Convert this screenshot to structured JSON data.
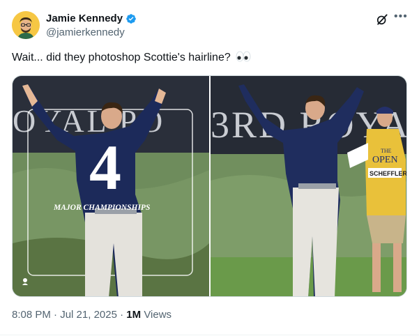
{
  "author": {
    "display_name": "Jamie Kennedy",
    "handle": "@jamierkennedy",
    "verified": true,
    "avatar_color": "#f6c744"
  },
  "tweet": {
    "text": "Wait... did they photoshop Scottie's hairline?",
    "emoji": "eyes-emoji"
  },
  "media": {
    "left_image": {
      "banner_text": "OYAL PO",
      "overlay_number": "4",
      "overlay_caption": "MAJOR CHAMPIONSHIPS"
    },
    "right_image": {
      "banner_text": "3RD ROYA",
      "caddie_bib_line1": "THE",
      "caddie_bib_line2": "OPEN",
      "caddie_name": "SCHEFFLER"
    }
  },
  "meta": {
    "time": "8:08 PM",
    "date": "Jul 21, 2025",
    "views_count": "1M",
    "views_label": "Views"
  },
  "colors": {
    "verified_blue": "#1d9bf0",
    "secondary_text": "#536471"
  }
}
